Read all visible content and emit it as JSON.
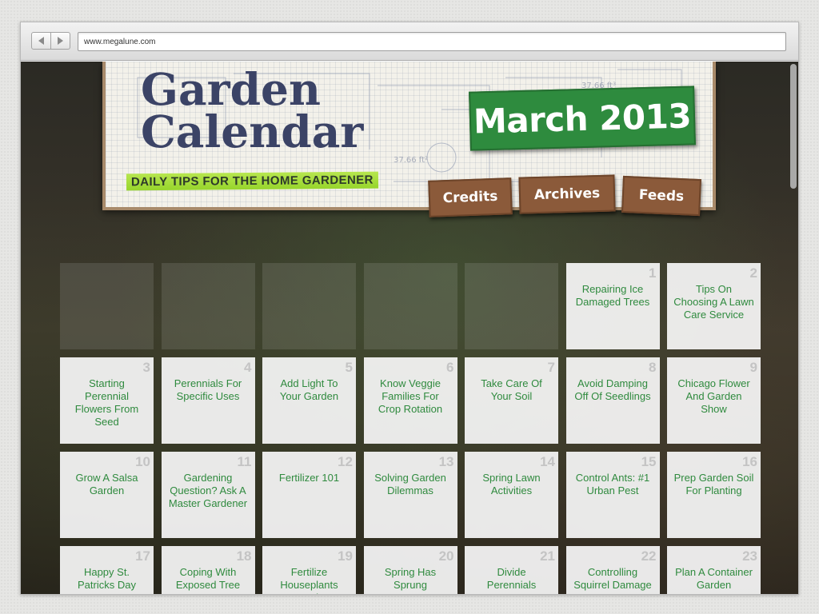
{
  "browser": {
    "url": "www.megalune.com",
    "back_icon": "back-arrow-icon",
    "forward_icon": "forward-arrow-icon"
  },
  "header": {
    "title_line1": "Garden",
    "title_line2": "Calendar",
    "tagline": "DAILY TIPS FOR THE HOME GARDENER",
    "month": "March 2013",
    "nav": [
      "Credits",
      "Archives",
      "Feeds"
    ]
  },
  "calendar": {
    "leading_empty_days": 5,
    "days": [
      {
        "day": "1",
        "tip": "Repairing Ice Damaged Trees"
      },
      {
        "day": "2",
        "tip": "Tips On Choosing A Lawn Care Service"
      },
      {
        "day": "3",
        "tip": "Starting Perennial Flowers From Seed"
      },
      {
        "day": "4",
        "tip": "Perennials For Specific Uses"
      },
      {
        "day": "5",
        "tip": "Add Light To Your Garden"
      },
      {
        "day": "6",
        "tip": "Know Veggie Families For Crop Rotation"
      },
      {
        "day": "7",
        "tip": "Take Care Of Your Soil"
      },
      {
        "day": "8",
        "tip": "Avoid Damping Off Of Seedlings"
      },
      {
        "day": "9",
        "tip": "Chicago Flower And Garden Show"
      },
      {
        "day": "10",
        "tip": "Grow A Salsa Garden"
      },
      {
        "day": "11",
        "tip": "Gardening Question? Ask A Master Gardener"
      },
      {
        "day": "12",
        "tip": "Fertilizer 101"
      },
      {
        "day": "13",
        "tip": "Solving Garden Dilemmas"
      },
      {
        "day": "14",
        "tip": "Spring Lawn Activities"
      },
      {
        "day": "15",
        "tip": "Control Ants: #1 Urban Pest"
      },
      {
        "day": "16",
        "tip": "Prep Garden Soil For Planting"
      },
      {
        "day": "17",
        "tip": "Happy St. Patricks Day"
      },
      {
        "day": "18",
        "tip": "Coping With Exposed Tree Roots"
      },
      {
        "day": "19",
        "tip": "Fertilize Houseplants March-September"
      },
      {
        "day": "20",
        "tip": "Spring Has Sprung"
      },
      {
        "day": "21",
        "tip": "Divide Perennials"
      },
      {
        "day": "22",
        "tip": "Controlling Squirrel Damage"
      },
      {
        "day": "23",
        "tip": "Plan A Container Garden"
      }
    ]
  },
  "colors": {
    "title": "#3b4366",
    "badge_green": "#2e8b3e",
    "tab_brown": "#8b5a3a",
    "tip_text": "#2f8a3e",
    "tagline_highlight": "#a6dd3a"
  }
}
